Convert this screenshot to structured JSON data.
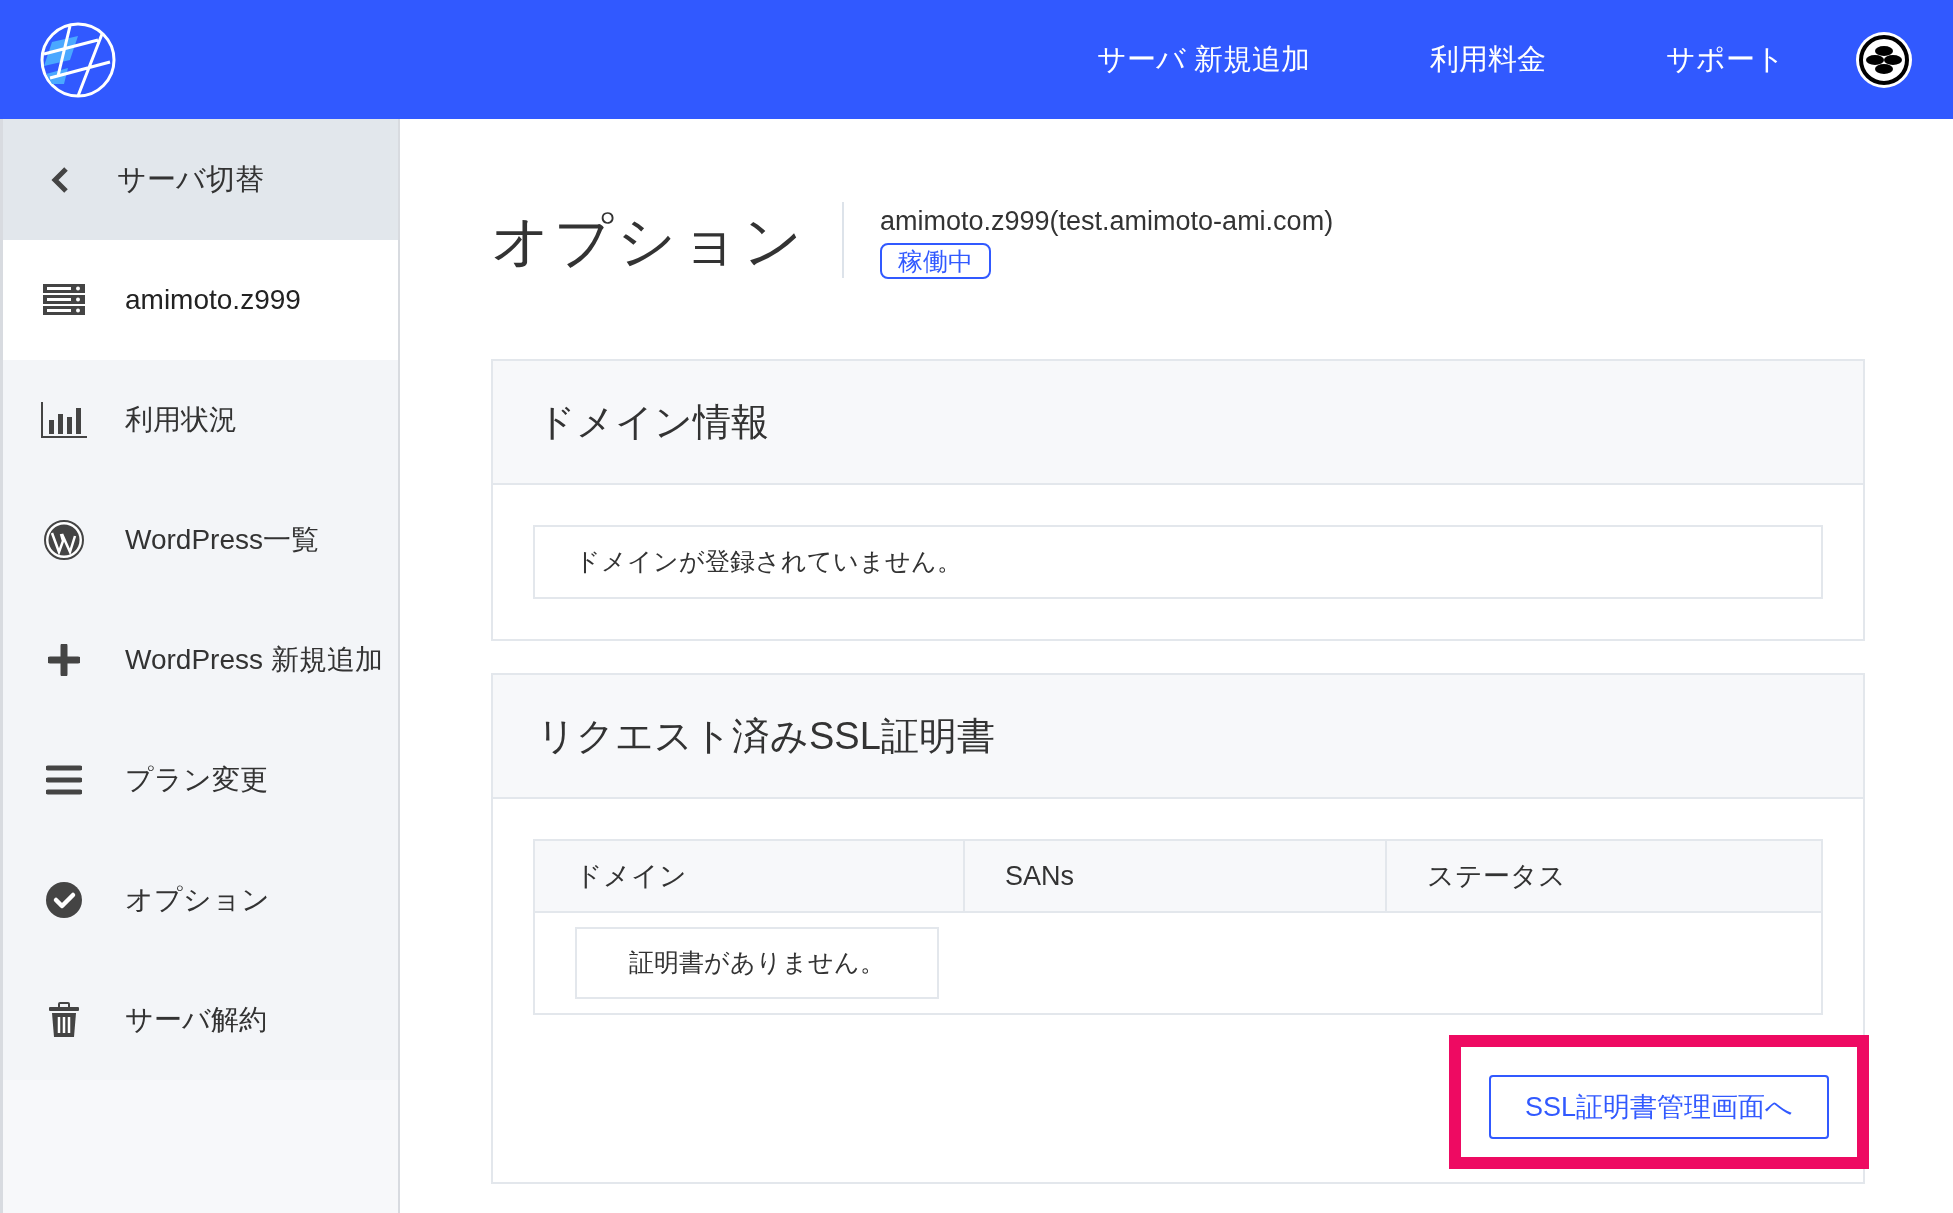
{
  "header": {
    "nav": [
      "サーバ 新規追加",
      "利用料金",
      "サポート"
    ]
  },
  "sidebar": {
    "back": "サーバ切替",
    "items": [
      {
        "kind": "server",
        "label": "amimoto.z999",
        "selected": true
      },
      {
        "kind": "chart",
        "label": "利用状況",
        "selected": false
      },
      {
        "kind": "wordpress",
        "label": "WordPress一覧",
        "selected": false
      },
      {
        "kind": "plus",
        "label": "WordPress 新規追加",
        "selected": false
      },
      {
        "kind": "menu",
        "label": "プラン変更",
        "selected": false
      },
      {
        "kind": "check",
        "label": "オプション",
        "selected": false
      },
      {
        "kind": "trash",
        "label": "サーバ解約",
        "selected": false
      }
    ]
  },
  "page": {
    "title": "オプション",
    "server": "amimoto.z999(test.amimoto-ami.com)",
    "status": "稼働中"
  },
  "domain_card": {
    "title": "ドメイン情報",
    "message": "ドメインが登録されていません。"
  },
  "ssl_card": {
    "title": "リクエスト済みSSL証明書",
    "table": {
      "columns": [
        "ドメイン",
        "SANs",
        "ステータス"
      ],
      "empty": "証明書がありません。"
    },
    "button": {
      "label": "SSL証明書管理画面へ",
      "highlighted": true
    }
  }
}
